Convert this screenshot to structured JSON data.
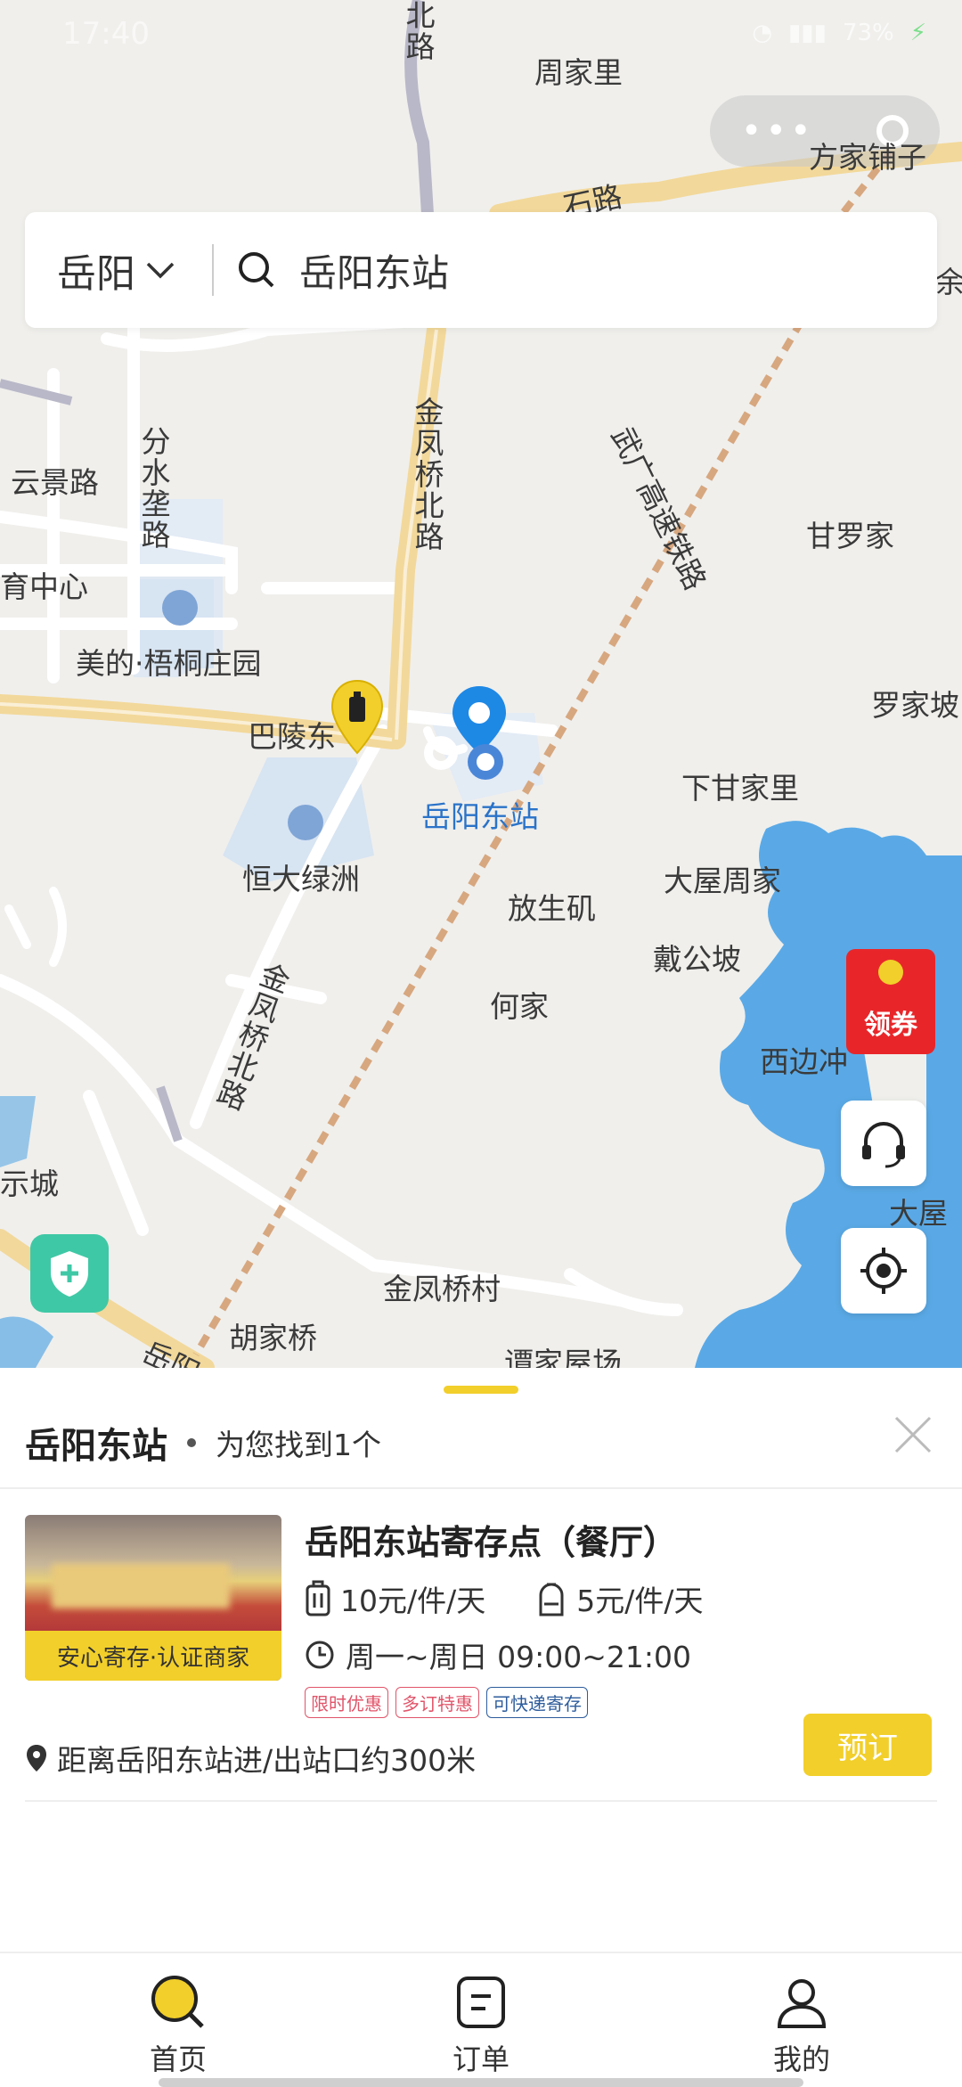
{
  "status_bar": {
    "time": "17:40",
    "battery": "73%"
  },
  "search": {
    "city": "岳阳",
    "query": "岳阳东站"
  },
  "map": {
    "labels": {
      "north_road": "北路",
      "zhoujiali": "周家里",
      "fangjiapuzi": "方家铺子",
      "shi_road": "石路",
      "yu": "余",
      "fenshuilong": "分水垄路",
      "yunjing": "云景路",
      "jinfengqiao_n": "金凤桥北路",
      "wuguang": "武广高速铁路",
      "ganluojia": "甘罗家",
      "tiyu": "育中心",
      "meide": "美的·梧桐庄园",
      "luojiapo": "罗家坡",
      "baling": "巴陵东",
      "station": "岳阳东站",
      "xiaganjia": "下甘家里",
      "hengda": "恒大绿洲",
      "fangshengji": "放生矶",
      "dawuzhou": "大屋周家",
      "daigongpo": "戴公坡",
      "jinfengqiao_s": "金凤桥北路",
      "hejia": "何家",
      "xibianchong": "西边冲",
      "biaocheng": "示城",
      "dawu2": "大屋",
      "jinfengqiaocun": "金凤桥村",
      "hujiaqiao": "胡家桥",
      "tanjiawu": "谭家屋场",
      "yue_bottom": "岳阳"
    }
  },
  "coupon": {
    "label": "领券"
  },
  "sheet": {
    "title": "岳阳东站",
    "found_text": "为您找到1个",
    "store": {
      "name": "岳阳东站寄存点（餐厅）",
      "badge": "安心寄存·认证商家",
      "price_luggage": "10元/件/天",
      "price_bag": "5元/件/天",
      "hours": "周一~周日 09:00~21:00",
      "tags": [
        "限时优惠",
        "多订特惠",
        "可快递寄存"
      ],
      "distance": "距离岳阳东站进/出站口约300米",
      "book_label": "预订"
    }
  },
  "tabs": [
    {
      "label": "首页",
      "icon": "search-icon",
      "active": true
    },
    {
      "label": "订单",
      "icon": "order-icon",
      "active": false
    },
    {
      "label": "我的",
      "icon": "profile-icon",
      "active": false
    }
  ],
  "colors": {
    "accent": "#f2cf2a",
    "water": "#5aa9e6",
    "pin": "#1e88e5",
    "coupon": "#e8262a",
    "shield": "#3fc8a5"
  }
}
